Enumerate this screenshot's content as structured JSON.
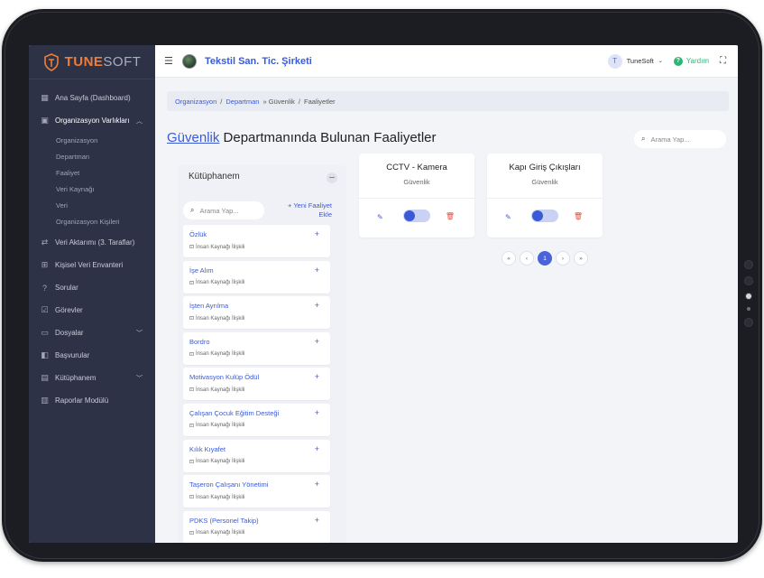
{
  "brand": {
    "name_strong": "TUNE",
    "name_light": "SOFT",
    "accent": "#ee7d3a"
  },
  "sidebar": {
    "items": [
      {
        "label": "Ana Sayfa (Dashboard)",
        "icon": "grid-icon"
      },
      {
        "label": "Organizasyon Varlıkları",
        "icon": "building-icon",
        "expanded": true
      },
      {
        "label": "Veri Aktarımı (3. Taraflar)",
        "icon": "transfer-icon"
      },
      {
        "label": "Kişisel Veri Envanteri",
        "icon": "table-icon"
      },
      {
        "label": "Sorular",
        "icon": "question-icon"
      },
      {
        "label": "Görevler",
        "icon": "checkbox-icon"
      },
      {
        "label": "Dosyalar",
        "icon": "folder-icon"
      },
      {
        "label": "Başvurular",
        "icon": "book-icon"
      },
      {
        "label": "Kütüphanem",
        "icon": "library-icon"
      },
      {
        "label": "Raporlar Modülü",
        "icon": "report-icon"
      }
    ],
    "subitems": [
      "Organizasyon",
      "Departman",
      "Faaliyet",
      "Veri Kaynağı",
      "Veri",
      "Organizasyon Kişileri"
    ]
  },
  "header": {
    "company": "Tekstil San. Tic. Şirketi",
    "user_initial": "T",
    "user_name": "TuneSoft",
    "help_label": "Yardım"
  },
  "breadcrumb": {
    "items": [
      "Organizasyon",
      "Departman",
      "» Güvenlik",
      "Faaliyetler"
    ]
  },
  "page": {
    "title_dept": "Güvenlik",
    "title_rest": " Departmanında Bulunan Faaliyetler",
    "search_placeholder": "Arama Yap..."
  },
  "library": {
    "title": "Kütüphanem",
    "search_placeholder": "Arama Yap...",
    "add_label_1": "Yeni Faaliyet",
    "add_label_2": "Ekle",
    "items": [
      {
        "name": "Özlük",
        "tag": "İnsan Kaynağı İlişkili"
      },
      {
        "name": "İşe Alım",
        "tag": "İnsan Kaynağı İlişkili"
      },
      {
        "name": "İşten Ayrılma",
        "tag": "İnsan Kaynağı İlişkili"
      },
      {
        "name": "Bordro",
        "tag": "İnsan Kaynağı İlişkili"
      },
      {
        "name": "Motivasyon Kulüp Ödül",
        "tag": "İnsan Kaynağı İlişkili"
      },
      {
        "name": "Çalışan Çocuk Eğitim Desteği",
        "tag": "İnsan Kaynağı İlişkili"
      },
      {
        "name": "Kılık Kıyafet",
        "tag": "İnsan Kaynağı İlişkili"
      },
      {
        "name": "Taşeron Çalışanı Yönetimi",
        "tag": "İnsan Kaynağı İlişkili"
      },
      {
        "name": "PDKS (Personel Takip)",
        "tag": "İnsan Kaynağı İlişkili"
      }
    ]
  },
  "activities": [
    {
      "title": "CCTV - Kamera",
      "dept": "Güvenlik"
    },
    {
      "title": "Kapı Giriş Çıkışları",
      "dept": "Güvenlik"
    }
  ],
  "pager": {
    "first": "«",
    "prev": "‹",
    "current": "1",
    "next": "›",
    "last": "»"
  }
}
